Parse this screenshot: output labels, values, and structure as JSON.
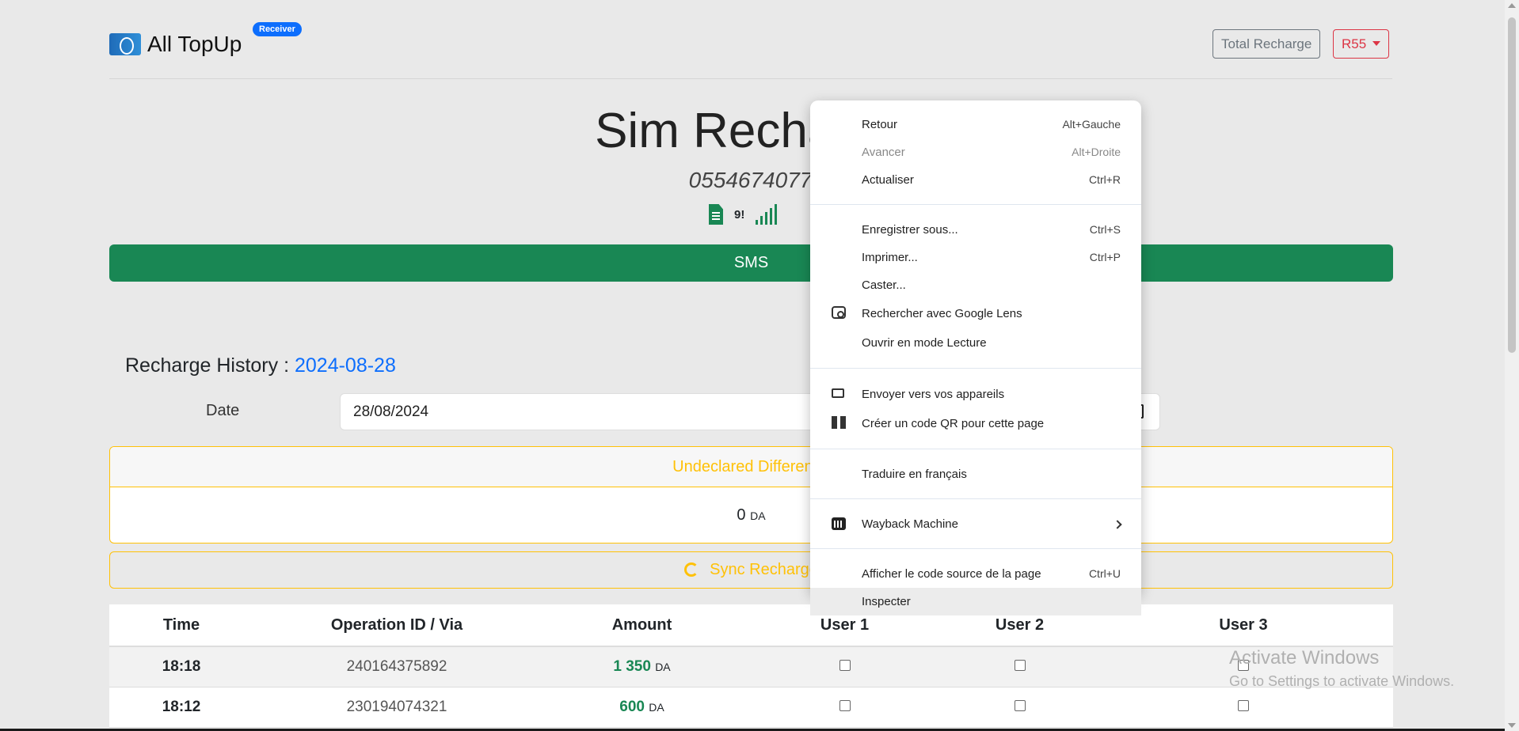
{
  "nav": {
    "brand": "All TopUp",
    "badge": "Receiver",
    "total_recharge": "Total Recharge",
    "account": "R55"
  },
  "header": {
    "title": "Sim Recharge",
    "phone": "0554674077",
    "sim_number": "9!"
  },
  "sms_label": "SMS",
  "history": {
    "label": "Recharge History :",
    "date": "2024-08-28",
    "date_field_label": "Date",
    "date_value": "28/08/2024"
  },
  "undeclared": {
    "title": "Undeclared Difference",
    "value": "0",
    "unit": "DA"
  },
  "sync_label": "Sync Recharge",
  "table": {
    "headers": [
      "Time",
      "Operation ID / Via",
      "Amount",
      "User 1",
      "User 2",
      "User 3"
    ],
    "rows": [
      {
        "time": "18:18",
        "op_id": "240164375892",
        "amount": "1 350",
        "unit": "DA"
      },
      {
        "time": "18:12",
        "op_id": "230194074321",
        "amount": "600",
        "unit": "DA"
      }
    ]
  },
  "watermark": {
    "line1": "Activate Windows",
    "line2": "Go to Settings to activate Windows."
  },
  "context_menu": {
    "items": [
      {
        "label": "Retour",
        "shortcut": "Alt+Gauche"
      },
      {
        "label": "Avancer",
        "shortcut": "Alt+Droite",
        "disabled": true
      },
      {
        "label": "Actualiser",
        "shortcut": "Ctrl+R"
      },
      {
        "label": "Enregistrer sous...",
        "shortcut": "Ctrl+S"
      },
      {
        "label": "Imprimer...",
        "shortcut": "Ctrl+P"
      },
      {
        "label": "Caster..."
      },
      {
        "label": "Rechercher avec Google Lens",
        "icon": "google-lens-icon"
      },
      {
        "label": "Ouvrir en mode Lecture"
      },
      {
        "label": "Envoyer vers vos appareils",
        "icon": "devices-icon"
      },
      {
        "label": "Créer un code QR pour cette page",
        "icon": "qr-code-icon"
      },
      {
        "label": "Traduire en français"
      },
      {
        "label": "Wayback Machine",
        "icon": "wayback-machine-icon",
        "submenu": true
      },
      {
        "label": "Afficher le code source de la page",
        "shortcut": "Ctrl+U"
      },
      {
        "label": "Inspecter",
        "highlighted": true
      }
    ]
  },
  "colors": {
    "success": "#198754",
    "warning": "#ffc107",
    "primary": "#0d6efd",
    "danger": "#dc3545"
  }
}
